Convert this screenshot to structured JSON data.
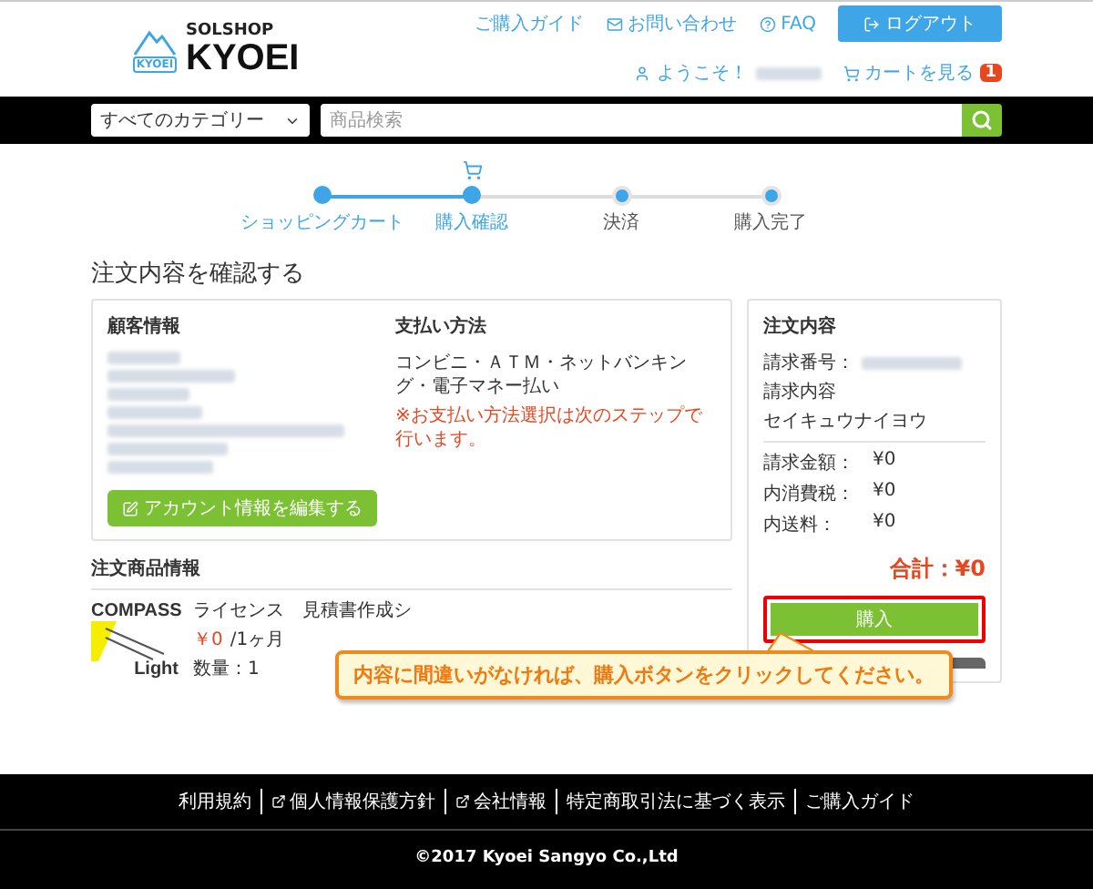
{
  "header": {
    "logo_top": "SOLSHOP",
    "logo_main": "KYOEI",
    "logo_badge": "KYOEI",
    "links": [
      {
        "label": "ご購入ガイド"
      },
      {
        "label": "お問い合わせ"
      },
      {
        "label": "FAQ"
      }
    ],
    "logout_button": "ログアウト",
    "welcome": "ようこそ！",
    "cart_link": "カートを見る",
    "cart_count": "1"
  },
  "search_bar": {
    "category": "すべてのカテゴリー",
    "placeholder": "商品検索"
  },
  "steps": [
    {
      "label": "ショッピングカート",
      "done": true,
      "selected": false
    },
    {
      "label": "購入確認",
      "done": true,
      "selected": true
    },
    {
      "label": "決済",
      "done": false,
      "selected": false
    },
    {
      "label": "購入完了",
      "done": false,
      "selected": false
    }
  ],
  "page_title": "注文内容を確認する",
  "customer": {
    "heading": "顧客情報",
    "edit_button": "アカウント情報を編集する"
  },
  "payment": {
    "heading": "支払い方法",
    "method": "コンビニ・ＡＴＭ・ネットバンキング・電子マネー払い",
    "note": "※お支払い方法選択は次のステップで行います。"
  },
  "summary": {
    "heading": "注文内容",
    "order_no_label": "請求番号：",
    "content_label": "請求内容",
    "content_value": "セイキュウナイヨウ",
    "amounts": [
      {
        "label": "請求金額：",
        "value": "¥0"
      },
      {
        "label": "内消費税：",
        "value": "¥0"
      },
      {
        "label": "内送料：",
        "value": "¥0"
      }
    ],
    "total": "合計：¥0",
    "buy_button": {
      "label": "購入",
      "highlighted": true
    }
  },
  "products": {
    "heading": "注文商品情報",
    "items": [
      {
        "logo_top": "COMPASS",
        "logo_bottom": "Light",
        "name": "ライセンス　見積書作成シ",
        "price": "￥0",
        "period": "/1ヶ月",
        "quantity": "数量：1"
      }
    ]
  },
  "callout": "内容に間違いがなければ、購入ボタンをクリックしてください。",
  "footer": {
    "links": [
      {
        "label": "利用規約",
        "external": false
      },
      {
        "label": "個人情報保護方針",
        "external": true
      },
      {
        "label": "会社情報",
        "external": true
      },
      {
        "label": "特定商取引法に基づく表示",
        "external": false
      },
      {
        "label": "ご購入ガイド",
        "external": false
      }
    ],
    "copyright": "©2017 Kyoei Sangyo Co.,Ltd"
  }
}
